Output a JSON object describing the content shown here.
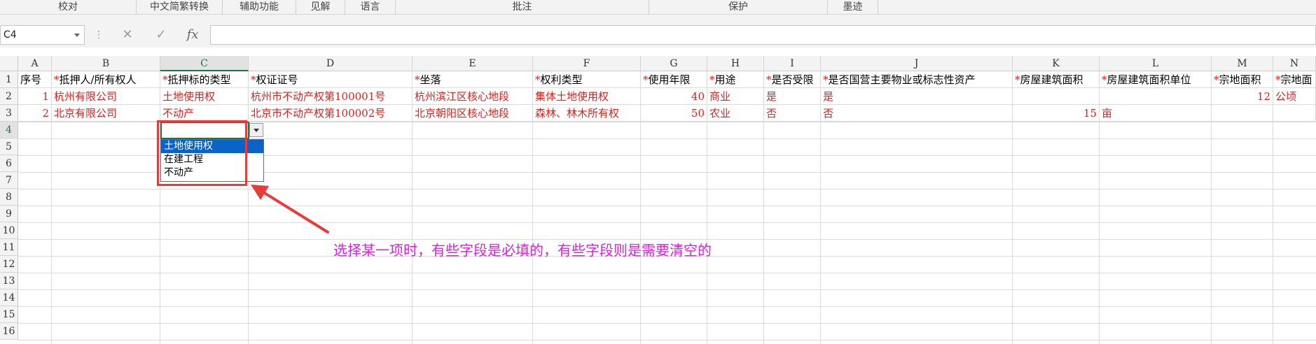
{
  "ribbon": {
    "groups": [
      "校对",
      "中文简繁转换",
      "辅助功能",
      "见解",
      "语言",
      "批注",
      "保护",
      "墨迹"
    ]
  },
  "formula_bar": {
    "name_box": "C4",
    "cancel_icon": "✕",
    "enter_icon": "✓",
    "fx_label": "fx",
    "formula_value": ""
  },
  "columns": [
    "A",
    "B",
    "C",
    "D",
    "E",
    "F",
    "G",
    "H",
    "I",
    "J",
    "K",
    "L",
    "M",
    "N"
  ],
  "rows": [
    "1",
    "2",
    "3",
    "4",
    "5",
    "6",
    "7",
    "8",
    "9",
    "10",
    "11",
    "12",
    "13",
    "14",
    "15",
    "16"
  ],
  "header_row": [
    {
      "text": "序号",
      "star": ""
    },
    {
      "text": "抵押人/所有权人",
      "star": "*"
    },
    {
      "text": "抵押标的类型",
      "star": "*"
    },
    {
      "text": "权证证号",
      "star": "*"
    },
    {
      "text": "坐落",
      "star": "*"
    },
    {
      "text": "权利类型",
      "star": "*"
    },
    {
      "text": "使用年限",
      "star": "*"
    },
    {
      "text": "用途",
      "star": "*"
    },
    {
      "text": "是否受限",
      "star": "*"
    },
    {
      "text": "是否国营主要物业或标志性资产",
      "star": "*"
    },
    {
      "text": "房屋建筑面积",
      "star": "*"
    },
    {
      "text": "房屋建筑面积单位",
      "star": "*"
    },
    {
      "text": "宗地面积",
      "star": "*"
    },
    {
      "text": "宗地面",
      "star": "*"
    }
  ],
  "data_rows": [
    [
      "1",
      "杭州有限公司",
      "土地使用权",
      "杭州市不动产权第100001号",
      "杭州滨江区核心地段",
      "集体土地使用权",
      "40",
      "商业",
      "是",
      "是",
      "",
      "",
      "12",
      "公顷"
    ],
    [
      "2",
      "北京有限公司",
      "不动产",
      "北京市不动产权第100002号",
      "北京朝阳区核心地段",
      "森林、林木所有权",
      "50",
      "农业",
      "否",
      "否",
      "15",
      "亩",
      "",
      ""
    ]
  ],
  "dropdown": {
    "options": [
      "土地使用权",
      "在建工程",
      "不动产"
    ],
    "highlighted_index": 0
  },
  "annotation": {
    "text": "选择某一项时，有些字段是必填的，有些字段则是需要清空的",
    "color": "#e21be6",
    "box_color": "#ea3b3b"
  },
  "colors": {
    "required_text": "#e0201c",
    "selection_accent": "#217346"
  }
}
